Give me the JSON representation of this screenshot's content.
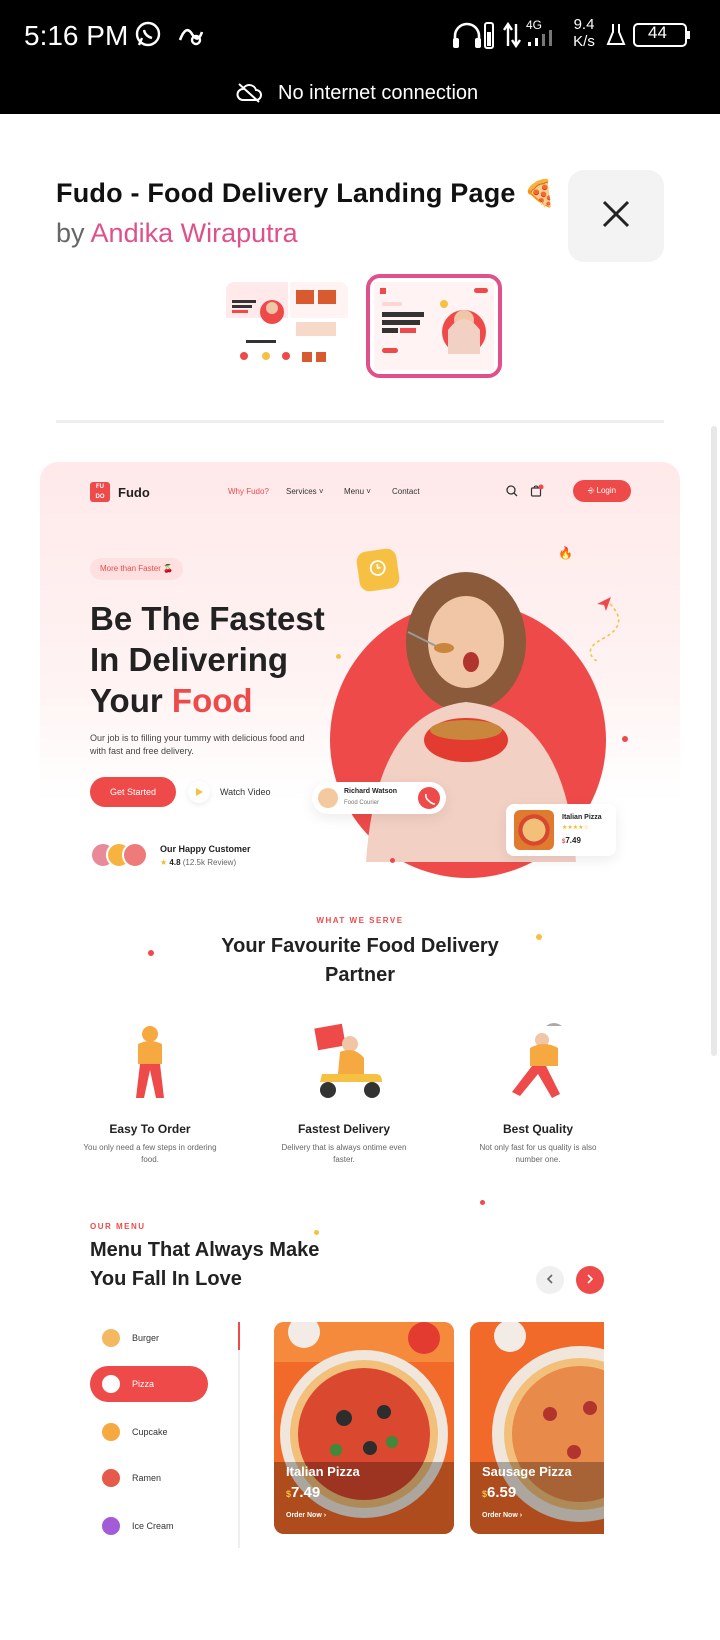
{
  "status_bar": {
    "time": "5:16 PM",
    "speed_value": "9.4",
    "speed_unit": "K/s",
    "network": "4G",
    "battery": "44"
  },
  "network_banner": {
    "message": "No internet connection"
  },
  "shot": {
    "title": "Fudo - Food Delivery Landing Page",
    "title_emoji": "🍕",
    "by_prefix": "by",
    "author": "Andika Wiraputra",
    "selected_thumbnail": 2
  },
  "design": {
    "brand": "Fudo",
    "logo_letters": [
      "F",
      "U",
      "D",
      "O"
    ],
    "nav": [
      "Why Fudo?",
      "Services",
      "Menu",
      "Contact"
    ],
    "login": "Login",
    "tag": "More than Faster",
    "hero_title_1": "Be The Fastest",
    "hero_title_2": "In Delivering",
    "hero_title_3": "Your",
    "hero_title_red": "Food",
    "hero_desc": "Our job is to filling your tummy with delicious food and with fast and free delivery.",
    "cta_primary": "Get Started",
    "cta_secondary": "Watch Video",
    "customers_title": "Our Happy Customer",
    "rating": "4.8",
    "reviews": "(12.5k Review)",
    "courier_name": "Richard Watson",
    "courier_role": "Food Courier",
    "pizza_card_name": "Italian Pizza",
    "pizza_card_currency": "$",
    "pizza_card_price": "7.49",
    "serve_eyebrow": "WHAT WE SERVE",
    "serve_title": "Your Favourite Food Delivery Partner",
    "features": [
      {
        "title": "Easy To Order",
        "desc": "You only need a few steps in ordering food."
      },
      {
        "title": "Fastest Delivery",
        "desc": "Delivery that is always ontime even faster."
      },
      {
        "title": "Best Quality",
        "desc": "Not only fast for us quality is also number one."
      }
    ],
    "menu_eyebrow": "OUR MENU",
    "menu_title": "Menu That Always Make You Fall In Love",
    "categories": [
      "Burger",
      "Pizza",
      "Cupcake",
      "Ramen",
      "Ice Cream"
    ],
    "active_category": "Pizza",
    "cards": [
      {
        "name": "Italian Pizza",
        "currency": "$",
        "price": "7.49",
        "cta": "Order Now"
      },
      {
        "name": "Sausage Pizza",
        "currency": "$",
        "price": "6.59",
        "cta": "Order Now"
      }
    ]
  },
  "colors": {
    "accent": "#ef4a4a",
    "author": "#e0508a",
    "yellow": "#f6c143"
  }
}
